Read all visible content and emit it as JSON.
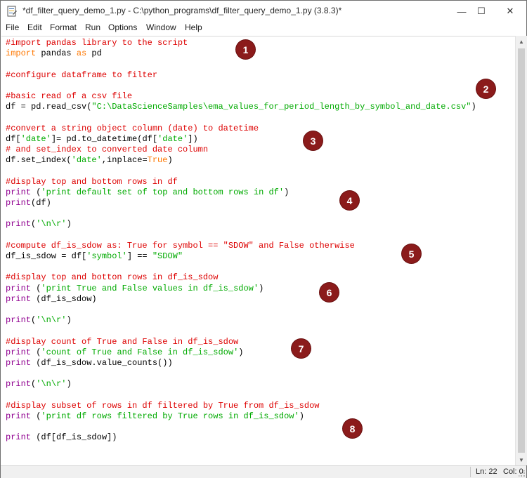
{
  "window": {
    "title": "*df_filter_query_demo_1.py - C:\\python_programs\\df_filter_query_demo_1.py (3.8.3)*",
    "minimize_glyph": "—",
    "maximize_glyph": "☐",
    "close_glyph": "✕"
  },
  "menu": [
    "File",
    "Edit",
    "Format",
    "Run",
    "Options",
    "Window",
    "Help"
  ],
  "status": {
    "line": "Ln: 22",
    "col": "Col: 0"
  },
  "badges": [
    "1",
    "2",
    "3",
    "4",
    "5",
    "6",
    "7",
    "8"
  ],
  "code_lines": [
    [
      [
        "comment",
        "#import pandas library to the script"
      ]
    ],
    [
      [
        "kw",
        "import"
      ],
      [
        "plain",
        " pandas "
      ],
      [
        "kw",
        "as"
      ],
      [
        "plain",
        " pd"
      ]
    ],
    [
      [
        "plain",
        ""
      ]
    ],
    [
      [
        "comment",
        "#configure dataframe to filter"
      ]
    ],
    [
      [
        "plain",
        ""
      ]
    ],
    [
      [
        "comment",
        "#basic read of a csv file"
      ]
    ],
    [
      [
        "plain",
        "df = pd.read_csv("
      ],
      [
        "str",
        "\"C:\\DataScienceSamples\\ema_values_for_period_length_by_symbol_and_date.csv\""
      ],
      [
        "plain",
        ")"
      ]
    ],
    [
      [
        "plain",
        ""
      ]
    ],
    [
      [
        "comment",
        "#convert a string object column (date) to datetime"
      ]
    ],
    [
      [
        "plain",
        "df["
      ],
      [
        "str",
        "'date'"
      ],
      [
        "plain",
        "]= pd.to_datetime(df["
      ],
      [
        "str",
        "'date'"
      ],
      [
        "plain",
        "])"
      ]
    ],
    [
      [
        "comment",
        "# and set_index to converted date column"
      ]
    ],
    [
      [
        "plain",
        "df.set_index("
      ],
      [
        "str",
        "'date'"
      ],
      [
        "plain",
        ",inplace="
      ],
      [
        "kw",
        "True"
      ],
      [
        "plain",
        ")"
      ]
    ],
    [
      [
        "plain",
        ""
      ]
    ],
    [
      [
        "comment",
        "#display top and bottom rows in df"
      ]
    ],
    [
      [
        "builtin",
        "print"
      ],
      [
        "plain",
        " ("
      ],
      [
        "str",
        "'print default set of top and bottom rows in df'"
      ],
      [
        "plain",
        ")"
      ]
    ],
    [
      [
        "builtin",
        "print"
      ],
      [
        "plain",
        "(df)"
      ]
    ],
    [
      [
        "plain",
        ""
      ]
    ],
    [
      [
        "builtin",
        "print"
      ],
      [
        "plain",
        "("
      ],
      [
        "str",
        "'\\n\\r'"
      ],
      [
        "plain",
        ")"
      ]
    ],
    [
      [
        "plain",
        ""
      ]
    ],
    [
      [
        "comment",
        "#compute df_is_sdow as: True for symbol == \"SDOW\" and False otherwise"
      ]
    ],
    [
      [
        "plain",
        "df_is_sdow = df["
      ],
      [
        "str",
        "'symbol'"
      ],
      [
        "plain",
        "] == "
      ],
      [
        "str",
        "\"SDOW\""
      ]
    ],
    [
      [
        "plain",
        ""
      ]
    ],
    [
      [
        "comment",
        "#display top and botton rows in df_is_sdow"
      ]
    ],
    [
      [
        "builtin",
        "print"
      ],
      [
        "plain",
        " ("
      ],
      [
        "str",
        "'print True and False values in df_is_sdow'"
      ],
      [
        "plain",
        ")"
      ]
    ],
    [
      [
        "builtin",
        "print"
      ],
      [
        "plain",
        " (df_is_sdow)"
      ]
    ],
    [
      [
        "plain",
        ""
      ]
    ],
    [
      [
        "builtin",
        "print"
      ],
      [
        "plain",
        "("
      ],
      [
        "str",
        "'\\n\\r'"
      ],
      [
        "plain",
        ")"
      ]
    ],
    [
      [
        "plain",
        ""
      ]
    ],
    [
      [
        "comment",
        "#display count of True and False in df_is_sdow"
      ]
    ],
    [
      [
        "builtin",
        "print"
      ],
      [
        "plain",
        " ("
      ],
      [
        "str",
        "'count of True and False in df_is_sdow'"
      ],
      [
        "plain",
        ")"
      ]
    ],
    [
      [
        "builtin",
        "print"
      ],
      [
        "plain",
        " (df_is_sdow.value_counts())"
      ]
    ],
    [
      [
        "plain",
        ""
      ]
    ],
    [
      [
        "builtin",
        "print"
      ],
      [
        "plain",
        "("
      ],
      [
        "str",
        "'\\n\\r'"
      ],
      [
        "plain",
        ")"
      ]
    ],
    [
      [
        "plain",
        ""
      ]
    ],
    [
      [
        "comment",
        "#display subset of rows in df filtered by True from df_is_sdow"
      ]
    ],
    [
      [
        "builtin",
        "print"
      ],
      [
        "plain",
        " ("
      ],
      [
        "str",
        "'print df rows filtered by True rows in df_is_sdow'"
      ],
      [
        "plain",
        ")"
      ]
    ],
    [
      [
        "plain",
        ""
      ]
    ],
    [
      [
        "builtin",
        "print"
      ],
      [
        "plain",
        " (df[df_is_sdow])"
      ]
    ]
  ],
  "colors": {
    "comment": "#dd0000",
    "keyword": "#ff7700",
    "string": "#00aa00",
    "builtin": "#900090",
    "badge": "#8b1b1b"
  },
  "icons": {
    "app": "idle-python-file-icon",
    "scroll_up": "up-arrow-icon",
    "scroll_down": "down-arrow-icon"
  }
}
